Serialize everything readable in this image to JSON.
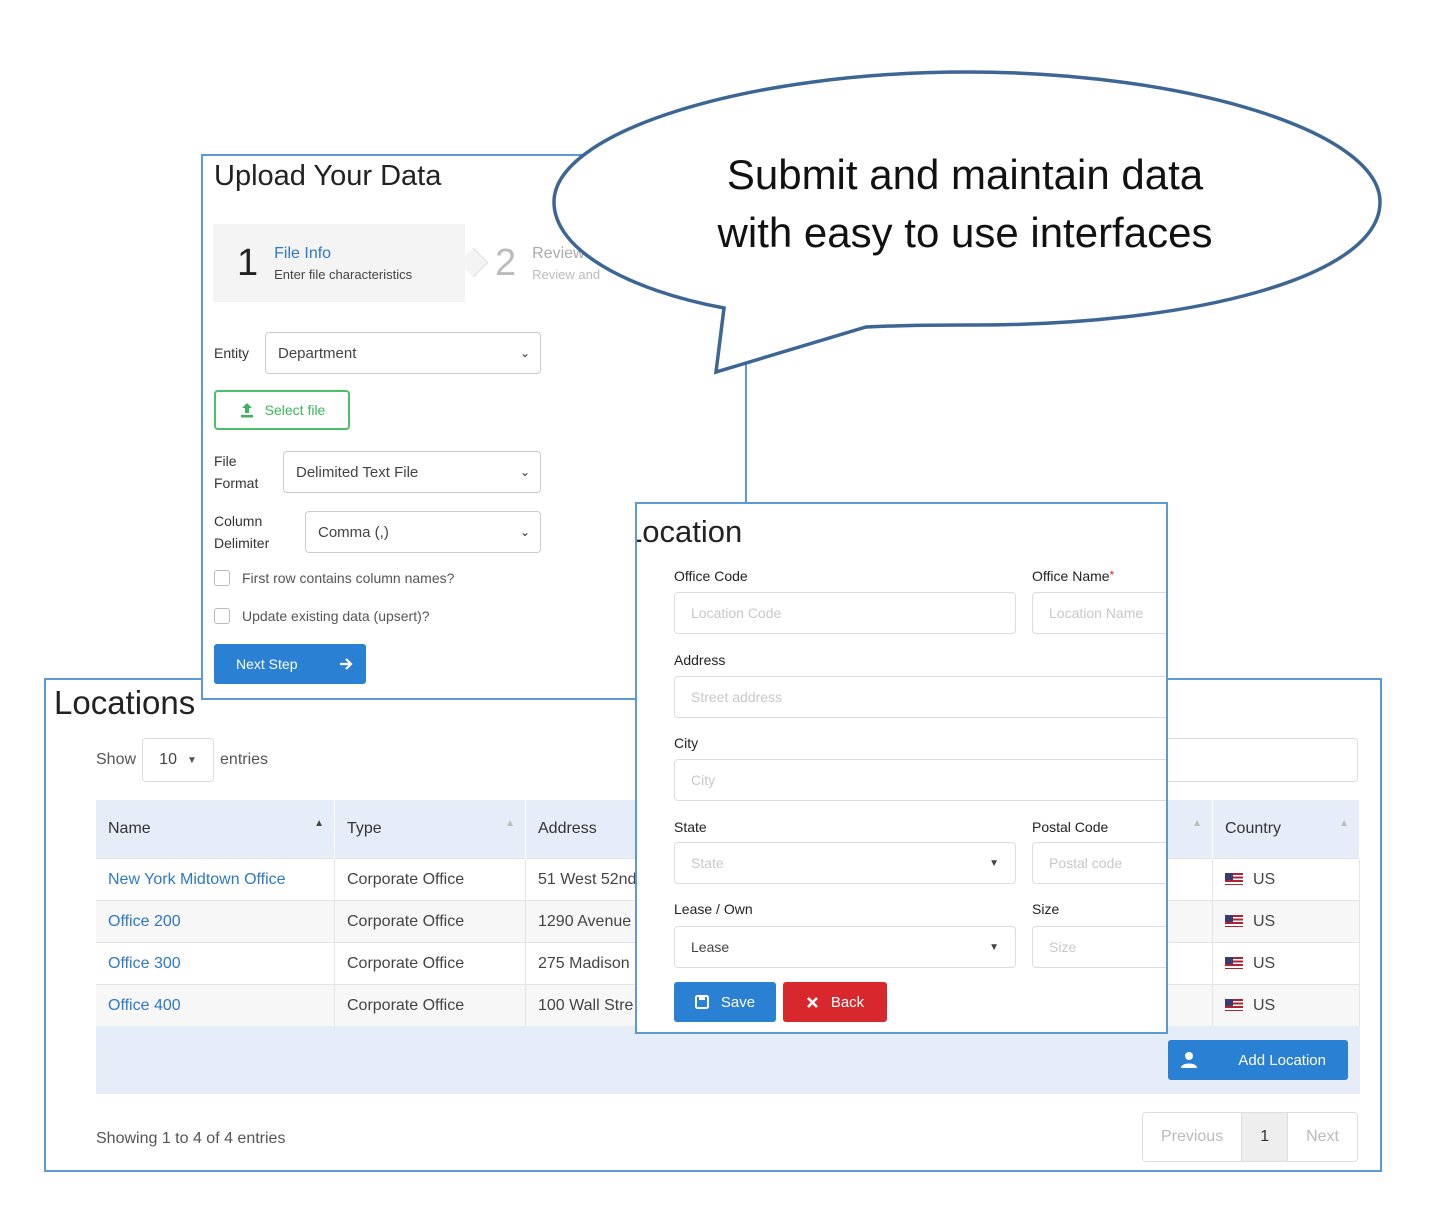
{
  "bubble": {
    "line1": "Submit and maintain data",
    "line2": "with easy to use interfaces"
  },
  "upload": {
    "title": "Upload Your Data",
    "steps": [
      {
        "num": "1",
        "title": "File Info",
        "subtitle": "Enter file characteristics"
      },
      {
        "num": "2",
        "title": "Review",
        "subtitle": "Review and"
      }
    ],
    "entity_label": "Entity",
    "entity_value": "Department",
    "select_file_label": "Select file",
    "file_format_label_1": "File",
    "file_format_label_2": "Format",
    "file_format_value": "Delimited Text File",
    "delimiter_label_1": "Column",
    "delimiter_label_2": "Delimiter",
    "delimiter_value": "Comma (,)",
    "checkbox_first_row": "First row contains column names?",
    "checkbox_upsert": "Update existing data (upsert)?",
    "next_step_label": "Next Step"
  },
  "locations": {
    "title": "Locations",
    "show_label": "Show",
    "page_length": "10",
    "entries_label": "entries",
    "columns": [
      "Name",
      "Type",
      "Address",
      "Country"
    ],
    "rows": [
      {
        "name": "New York Midtown Office",
        "type": "Corporate Office",
        "address": "51 West 52nd",
        "country": "US"
      },
      {
        "name": "Office 200",
        "type": "Corporate Office",
        "address": "1290 Avenue",
        "country": "US"
      },
      {
        "name": "Office 300",
        "type": "Corporate Office",
        "address": "275 Madison",
        "country": "US"
      },
      {
        "name": "Office 400",
        "type": "Corporate Office",
        "address": "100 Wall Stre",
        "country": "US"
      }
    ],
    "add_location_label": "Add Location",
    "info": "Showing 1 to 4 of 4 entries",
    "pager": {
      "previous": "Previous",
      "current": "1",
      "next": "Next"
    }
  },
  "location_form": {
    "title": "Location",
    "office_code_label": "Office Code",
    "office_code_placeholder": "Location Code",
    "office_name_label": "Office Name",
    "office_name_required": "*",
    "office_name_placeholder": "Location Name",
    "address_label": "Address",
    "address_placeholder": "Street address",
    "city_label": "City",
    "city_placeholder": "City",
    "state_label": "State",
    "state_placeholder": "State",
    "postal_label": "Postal Code",
    "postal_placeholder": "Postal code",
    "lease_label": "Lease / Own",
    "lease_value": "Lease",
    "size_label": "Size",
    "size_placeholder": "Size",
    "save_label": "Save",
    "back_label": "Back"
  },
  "colors": {
    "panel_border": "#5b9bd5",
    "primary": "#2a80d2",
    "danger": "#d9272e",
    "success": "#4cc068",
    "link": "#2f78c5",
    "table_header": "#e6ecf8"
  }
}
